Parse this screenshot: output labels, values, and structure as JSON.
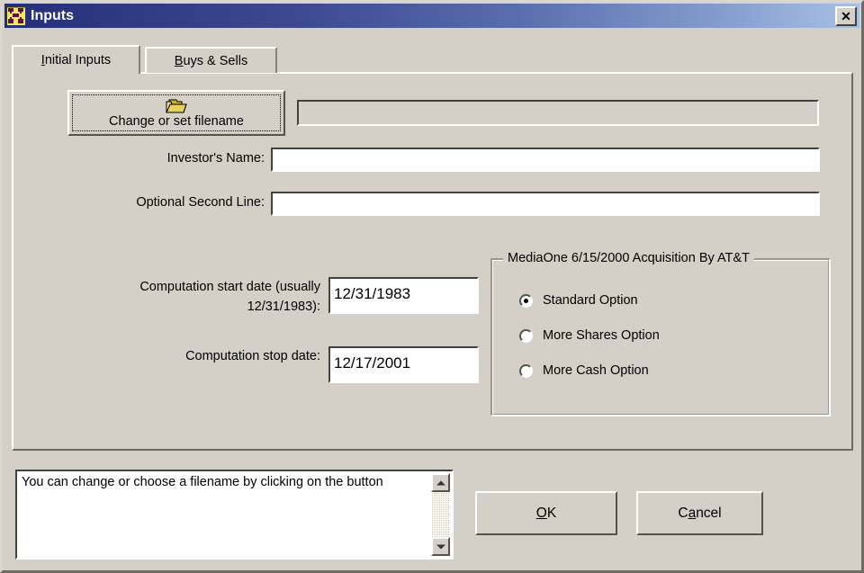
{
  "window": {
    "title": "Inputs",
    "icon": "org-chart-icon",
    "close_label": "✕",
    "bg_color": "#d4d0c8",
    "titlebar_gradient_from": "#252f77",
    "titlebar_gradient_to": "#a9c0e4"
  },
  "tabs": [
    {
      "label": "Initial Inputs",
      "accel": "I",
      "rest": "nitial Inputs",
      "active": true
    },
    {
      "label": "Buys & Sells",
      "accel": "B",
      "rest": "uys & Sells",
      "active": false
    }
  ],
  "filename_button": {
    "label": "Change or set filename",
    "icon": "open-folder-icon"
  },
  "filename_display": {
    "value": "",
    "enabled": false
  },
  "fields": [
    {
      "name": "investors-name",
      "label": "Investor's Name:",
      "value": "",
      "placeholder": ""
    },
    {
      "name": "optional-second-line",
      "label": "Optional Second Line:",
      "value": "",
      "placeholder": ""
    }
  ],
  "dates": {
    "start": {
      "label_line1": "Computation start date (usually",
      "label_line2": "12/31/1983):",
      "value": "12/31/1983"
    },
    "stop": {
      "label": "Computation stop date:",
      "value": "12/17/2001"
    }
  },
  "acquisition_group": {
    "title": "MediaOne 6/15/2000 Acquisition By AT&T",
    "options": [
      {
        "label": "Standard Option",
        "selected": true
      },
      {
        "label": "More Shares Option",
        "selected": false
      },
      {
        "label": "More Cash Option",
        "selected": false
      }
    ]
  },
  "help": {
    "text": "You can change or choose a filename by clicking on the button",
    "scroll_up_icon": "scroll-up-arrow-icon",
    "scroll_down_icon": "scroll-down-arrow-icon"
  },
  "buttons": {
    "ok": {
      "accel": "O",
      "rest": "K",
      "label": "OK"
    },
    "cancel": {
      "pre": "C",
      "accel": "a",
      "rest": "ncel",
      "label": "Cancel"
    }
  }
}
